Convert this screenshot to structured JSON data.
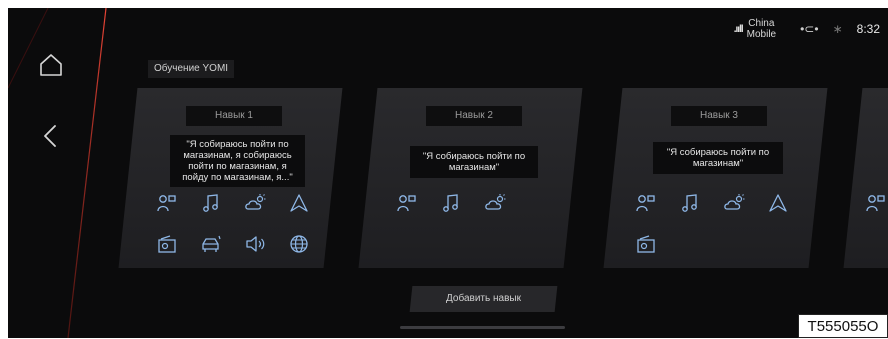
{
  "status": {
    "signal_bars": ".ııll",
    "carrier_line1": "China",
    "carrier_line2": "Mobile",
    "time": "8:32"
  },
  "page": {
    "title": "Обучение YOMI"
  },
  "skills": [
    {
      "label": "Навык 1",
      "phrase": "\"Я собираюсь пойти по магазинам, я собираюсь пойти по магазинам, я пойду по магазинам, я...\""
    },
    {
      "label": "Навык 2",
      "phrase": "\"Я собираюсь пойти по магазинам\""
    },
    {
      "label": "Навык 3",
      "phrase": "\"Я собираюсь пойти по магазинам\""
    }
  ],
  "actions": {
    "add_skill": "Добавить навык"
  },
  "watermark": "T555055O",
  "colors": {
    "accent": "#8fb8e8",
    "glow": "#c0392b",
    "background": "#0b0b0c"
  }
}
